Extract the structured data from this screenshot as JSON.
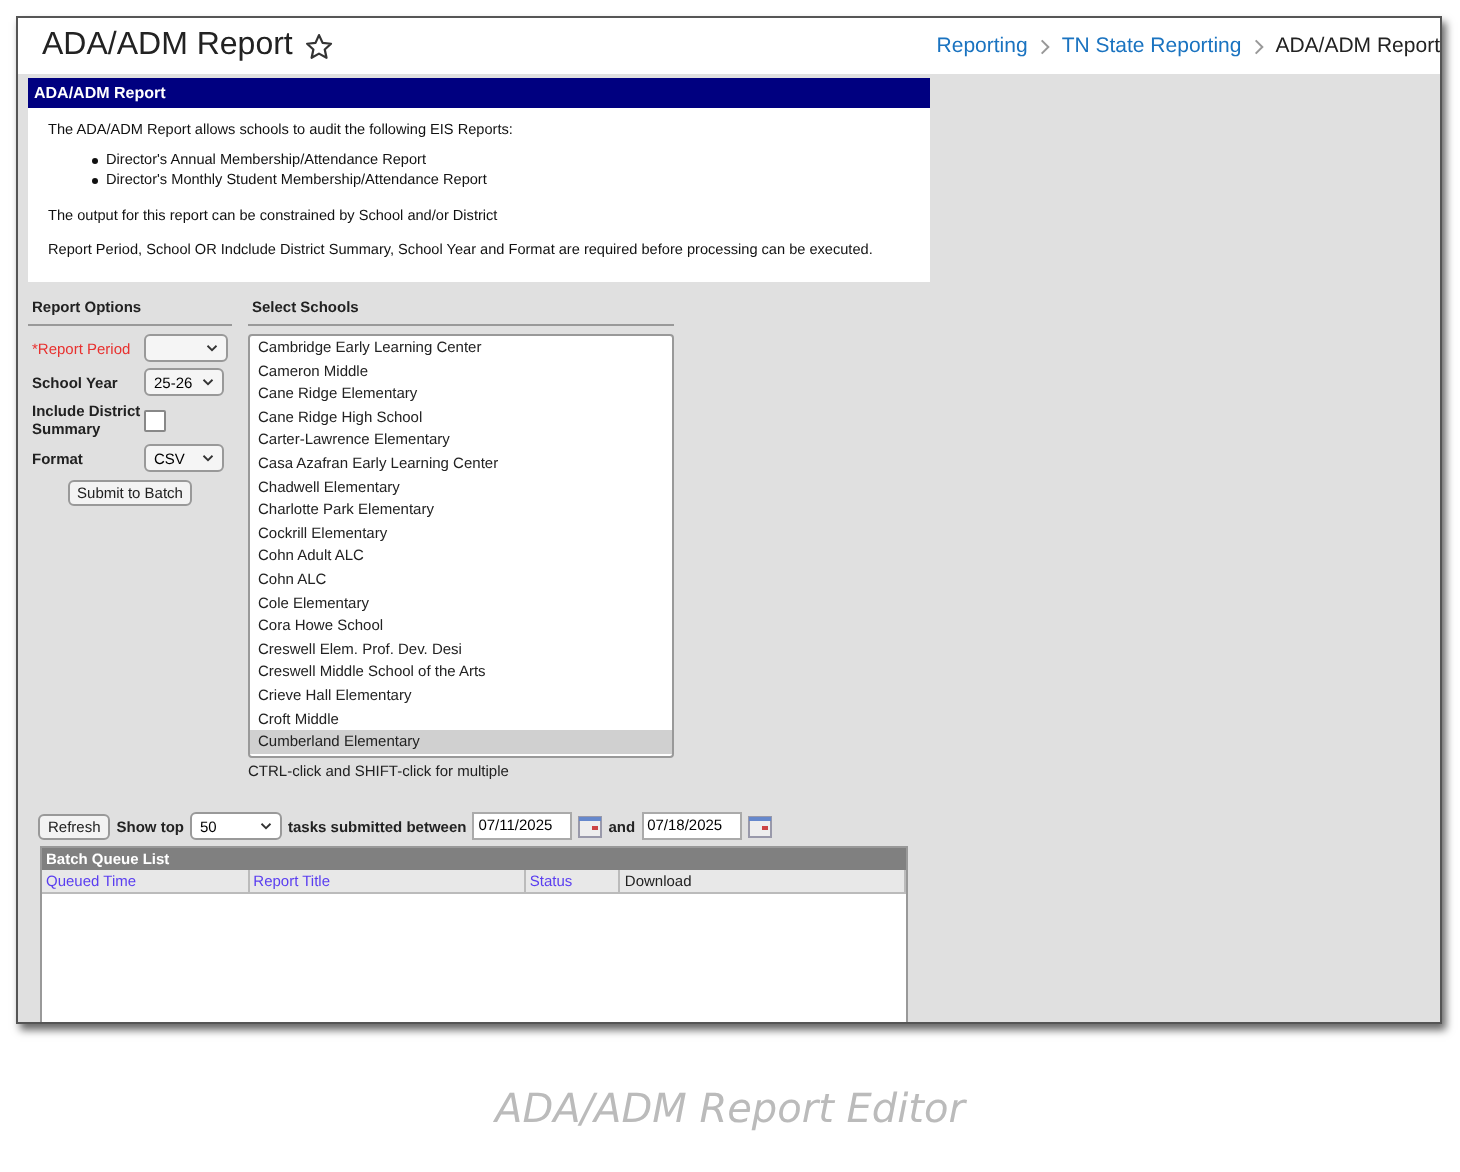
{
  "header": {
    "title": "ADA/ADM Report",
    "favorite": false,
    "breadcrumbs": [
      "Reporting",
      "TN State Reporting",
      "ADA/ADM Report"
    ]
  },
  "panel": {
    "title": "ADA/ADM Report",
    "intro": "The ADA/ADM Report allows schools to audit the following EIS Reports:",
    "bullets": [
      "Director's Annual Membership/Attendance Report",
      "Director's Monthly Student Membership/Attendance Report"
    ],
    "notes": [
      "The output for this report can be constrained by School and/or District",
      "Report Period, School OR Indclude District Summary, School Year and Format are required before processing can be executed."
    ]
  },
  "report_options": {
    "heading": "Report Options",
    "fields": [
      {
        "kind": "select",
        "label": "*Report Period",
        "required": true
      },
      {
        "kind": "select",
        "label": "School Year",
        "required": false,
        "value": "25-26"
      },
      {
        "kind": "checkbox",
        "label": "Include District Summary",
        "required": false,
        "checked": false
      },
      {
        "kind": "select",
        "label": "Format",
        "required": false,
        "value": "CSV"
      }
    ],
    "submit": "Submit to Batch"
  },
  "schools": {
    "heading": "Select Schools",
    "items": [
      {
        "name": "Cambridge Early Learning Center",
        "selected": false
      },
      {
        "name": "Cameron Middle",
        "selected": false
      },
      {
        "name": "Cane Ridge Elementary",
        "selected": false
      },
      {
        "name": "Cane Ridge High School",
        "selected": false
      },
      {
        "name": "Carter-Lawrence Elementary",
        "selected": false
      },
      {
        "name": "Casa Azafran Early Learning Center",
        "selected": false
      },
      {
        "name": "Chadwell Elementary",
        "selected": false
      },
      {
        "name": "Charlotte Park Elementary",
        "selected": false
      },
      {
        "name": "Cockrill Elementary",
        "selected": false
      },
      {
        "name": "Cohn Adult ALC",
        "selected": false
      },
      {
        "name": "Cohn ALC",
        "selected": false
      },
      {
        "name": "Cole Elementary",
        "selected": false
      },
      {
        "name": "Cora Howe School",
        "selected": false
      },
      {
        "name": "Creswell Elem. Prof. Dev. Desi",
        "selected": false
      },
      {
        "name": "Creswell Middle School of the Arts",
        "selected": false
      },
      {
        "name": "Crieve Hall Elementary",
        "selected": false
      },
      {
        "name": "Croft Middle",
        "selected": false
      },
      {
        "name": "Cumberland Elementary",
        "selected": true
      }
    ],
    "hint": "CTRL-click and SHIFT-click for multiple"
  },
  "batch": {
    "refresh": "Refresh",
    "show_top": "Show top",
    "top_value": "50",
    "between": "tasks submitted between",
    "start_date": "07/11/2025",
    "and": "and",
    "end_date": "07/18/2025",
    "list_title": "Batch Queue List",
    "columns": [
      {
        "label": "Queued Time",
        "link": true
      },
      {
        "label": "Report Title",
        "link": true
      },
      {
        "label": "Status",
        "link": true
      },
      {
        "label": "Download",
        "link": false
      }
    ]
  },
  "caption": "ADA/ADM Report Editor"
}
